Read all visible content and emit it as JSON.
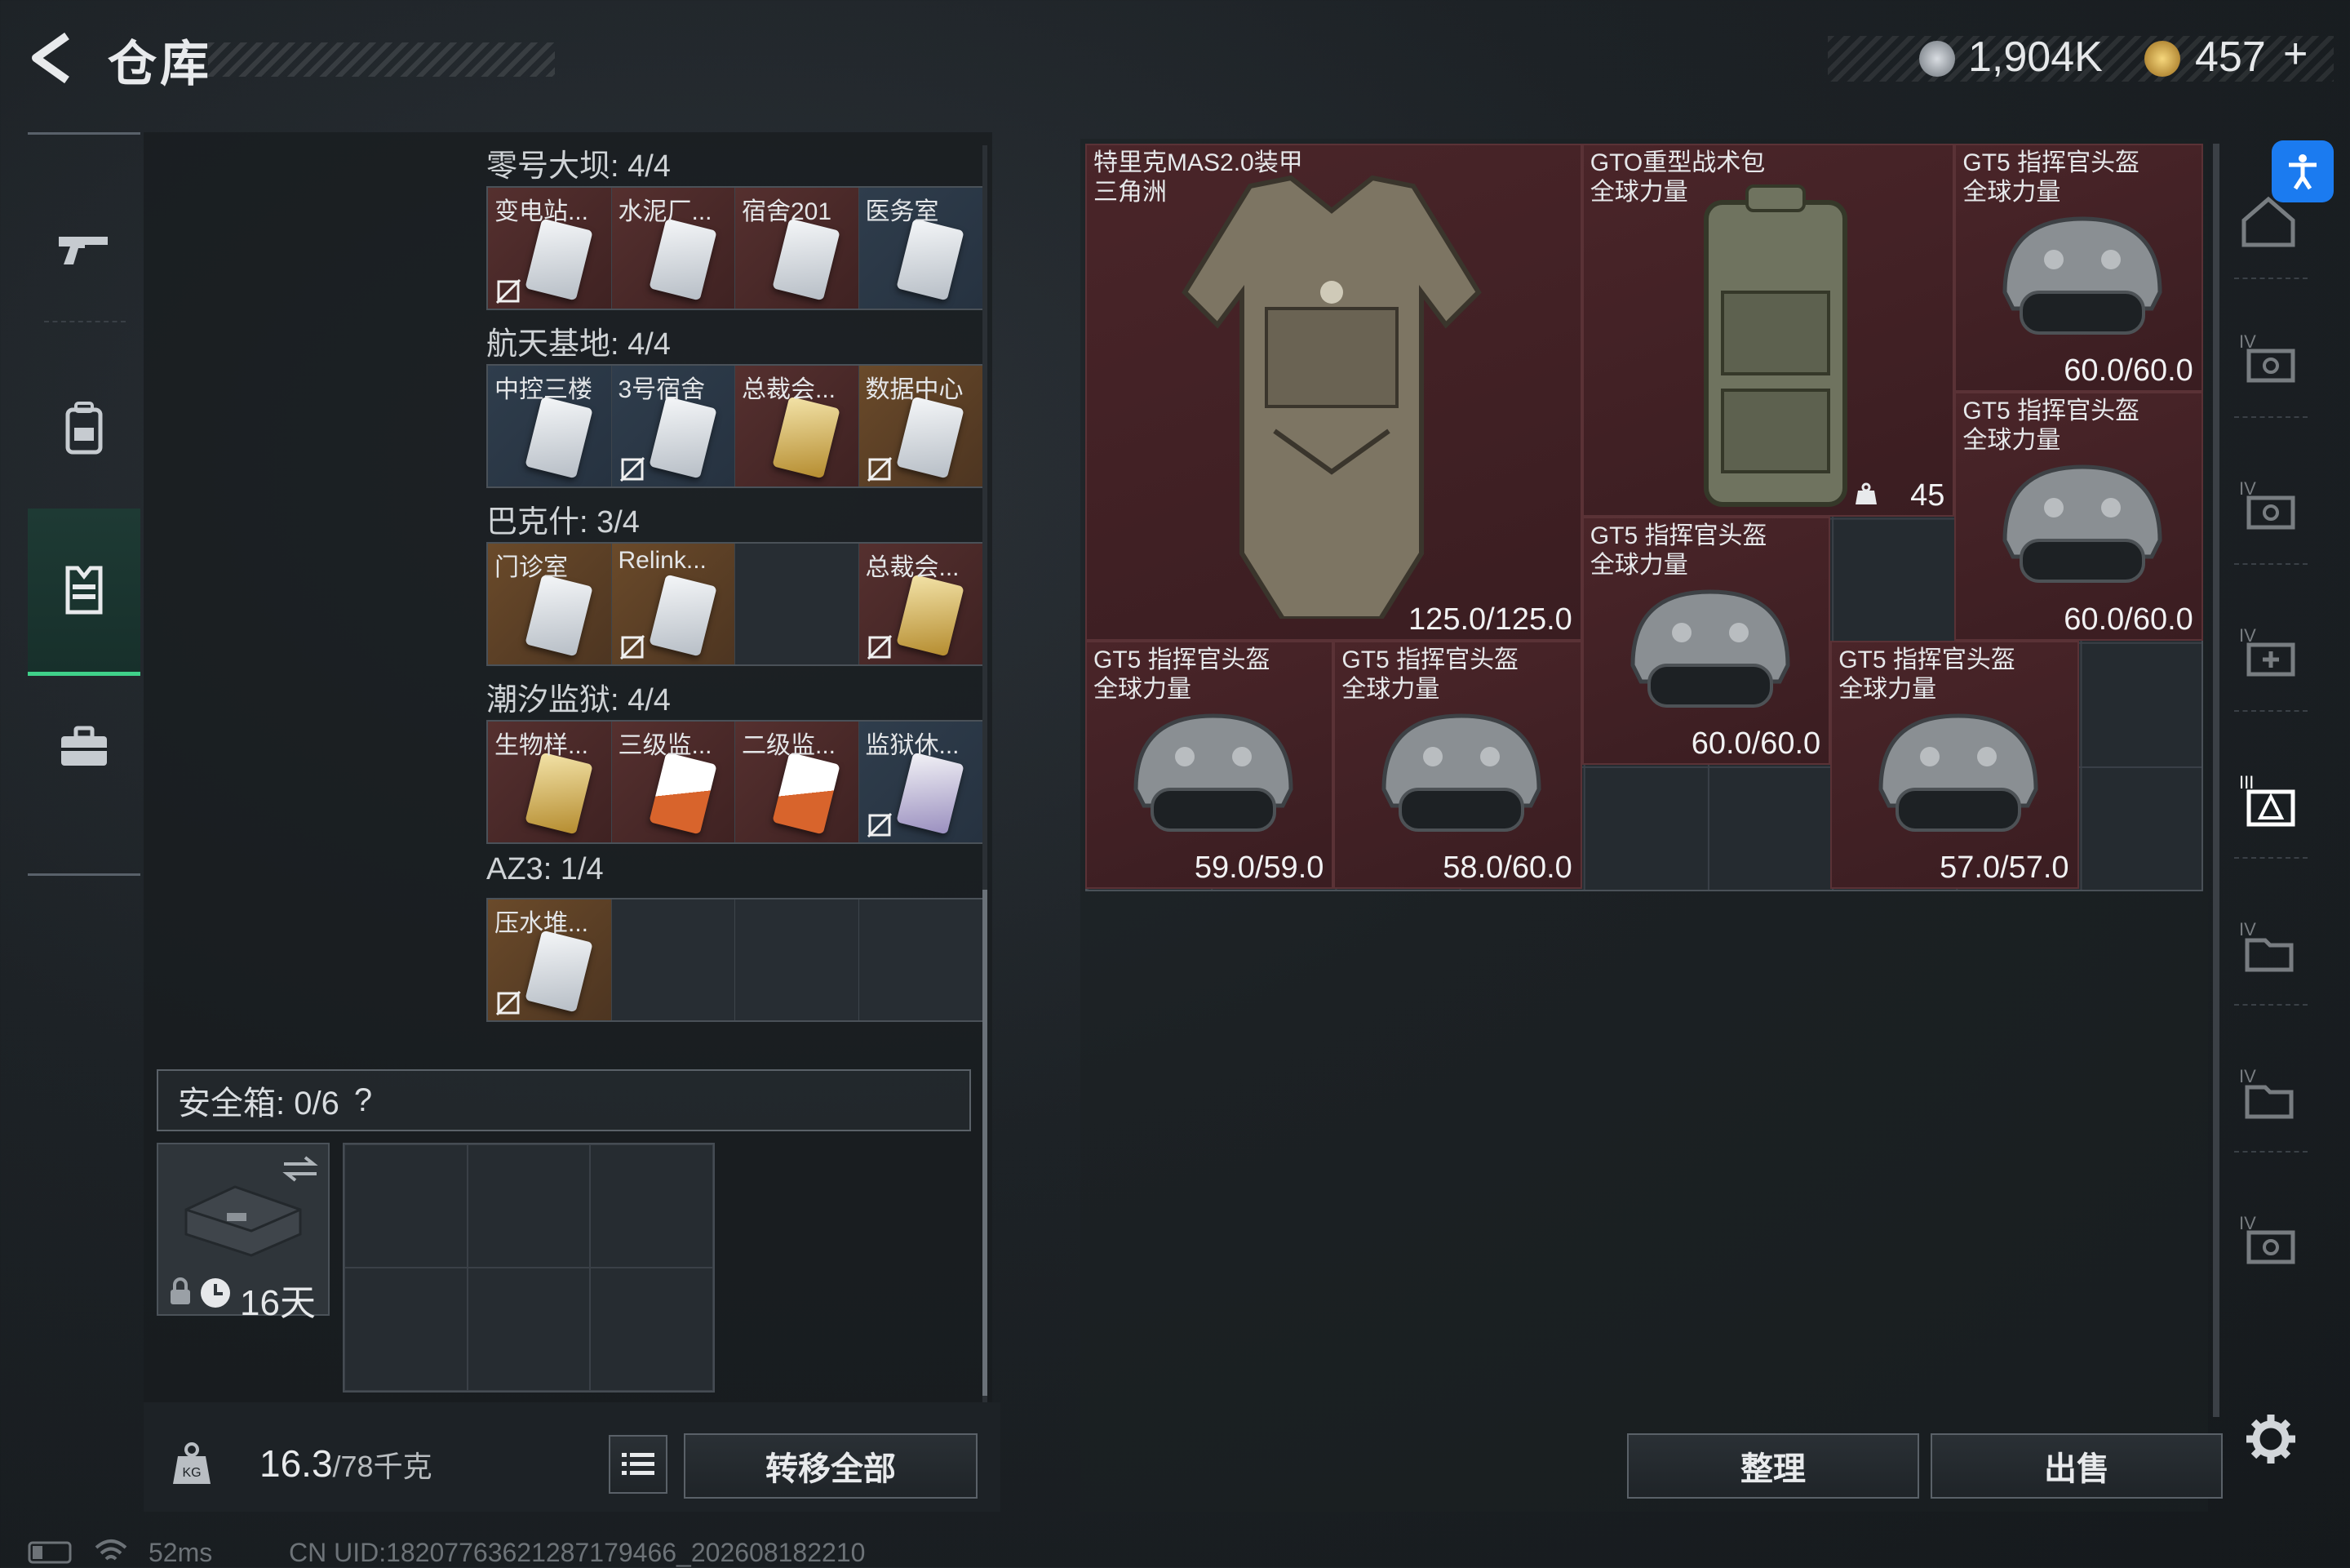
{
  "header": {
    "title": "仓库",
    "currency_1": "1,904K",
    "currency_2": "457",
    "add_label": "+"
  },
  "left_nav": {
    "items": [
      "weapon",
      "backpack",
      "armor-vest",
      "briefcase"
    ],
    "active_index": 2
  },
  "key_sections": [
    {
      "title": "零号大坝: 4/4",
      "slots": [
        {
          "label": "变电站...",
          "bg": "red",
          "card": "white",
          "no_check": true
        },
        {
          "label": "水泥厂...",
          "bg": "red",
          "card": "white",
          "no_check": false
        },
        {
          "label": "宿舍201",
          "bg": "red",
          "card": "white",
          "no_check": false
        },
        {
          "label": "医务室",
          "bg": "blue",
          "card": "white",
          "no_check": false
        }
      ]
    },
    {
      "title": "航天基地: 4/4",
      "slots": [
        {
          "label": "中控三楼",
          "bg": "blue",
          "card": "white",
          "no_check": false
        },
        {
          "label": "3号宿舍",
          "bg": "blue",
          "card": "white",
          "no_check": true
        },
        {
          "label": "总裁会...",
          "bg": "red",
          "card": "gold",
          "no_check": false
        },
        {
          "label": "数据中心",
          "bg": "gold",
          "card": "white",
          "no_check": true
        }
      ]
    },
    {
      "title": "巴克什: 3/4",
      "slots": [
        {
          "label": "门诊室",
          "bg": "gold",
          "card": "white",
          "no_check": false
        },
        {
          "label": "Relink...",
          "bg": "gold",
          "card": "white",
          "no_check": true
        },
        {
          "label": "",
          "bg": "empty",
          "card": "",
          "no_check": false
        },
        {
          "label": "总裁会...",
          "bg": "red",
          "card": "gold",
          "no_check": true
        }
      ]
    },
    {
      "title": "潮汐监狱: 4/4",
      "slots": [
        {
          "label": "生物样...",
          "bg": "red",
          "card": "gold",
          "no_check": false
        },
        {
          "label": "三级监...",
          "bg": "red",
          "card": "orange",
          "no_check": false
        },
        {
          "label": "二级监...",
          "bg": "red",
          "card": "orange",
          "no_check": false
        },
        {
          "label": "监狱休...",
          "bg": "blue",
          "card": "purple",
          "no_check": true
        }
      ]
    },
    {
      "title": "AZ3: 1/4",
      "slots": [
        {
          "label": "压水堆...",
          "bg": "gold",
          "card": "white",
          "no_check": true
        },
        {
          "label": "",
          "bg": "empty",
          "card": "",
          "no_check": false
        },
        {
          "label": "",
          "bg": "empty",
          "card": "",
          "no_check": false
        },
        {
          "label": "",
          "bg": "empty",
          "card": "",
          "no_check": false
        }
      ]
    }
  ],
  "safe_box": {
    "label": "安全箱: 0/6",
    "help": "?",
    "expiry": "16天"
  },
  "bottom_left": {
    "weight_current": "16.3",
    "weight_max": "/78千克",
    "transfer_all": "转移全部"
  },
  "stash_items": [
    {
      "name": "特里克MAS2.0装甲",
      "sub": "三角洲",
      "durability": "125.0/125.0",
      "type": "armor"
    },
    {
      "name": "GTO重型战术包",
      "sub": "全球力量",
      "durability": "45",
      "type": "backpack"
    },
    {
      "name": "GT5 指挥官头盔",
      "sub": "全球力量",
      "durability": "60.0/60.0",
      "type": "helmet"
    },
    {
      "name": "GT5 指挥官头盔",
      "sub": "全球力量",
      "durability": "60.0/60.0",
      "type": "helmet"
    },
    {
      "name": "GT5 指挥官头盔",
      "sub": "全球力量",
      "durability": "60.0/60.0",
      "type": "helmet"
    },
    {
      "name": "GT5 指挥官头盔",
      "sub": "全球力量",
      "durability": "59.0/59.0",
      "type": "helmet"
    },
    {
      "name": "GT5 指挥官头盔",
      "sub": "全球力量",
      "durability": "58.0/60.0",
      "type": "helmet"
    },
    {
      "name": "GT5 指挥官头盔",
      "sub": "全球力量",
      "durability": "57.0/57.0",
      "type": "helmet"
    }
  ],
  "right_buttons": {
    "organize": "整理",
    "sell": "出售"
  },
  "status": {
    "ping": "52ms",
    "uid": "CN UID:18207763621287179466_202608182210"
  },
  "colors": {
    "accent_green": "#3fd18a",
    "item_red": "#4a2529",
    "accessibility_blue": "#1b7bf0"
  }
}
